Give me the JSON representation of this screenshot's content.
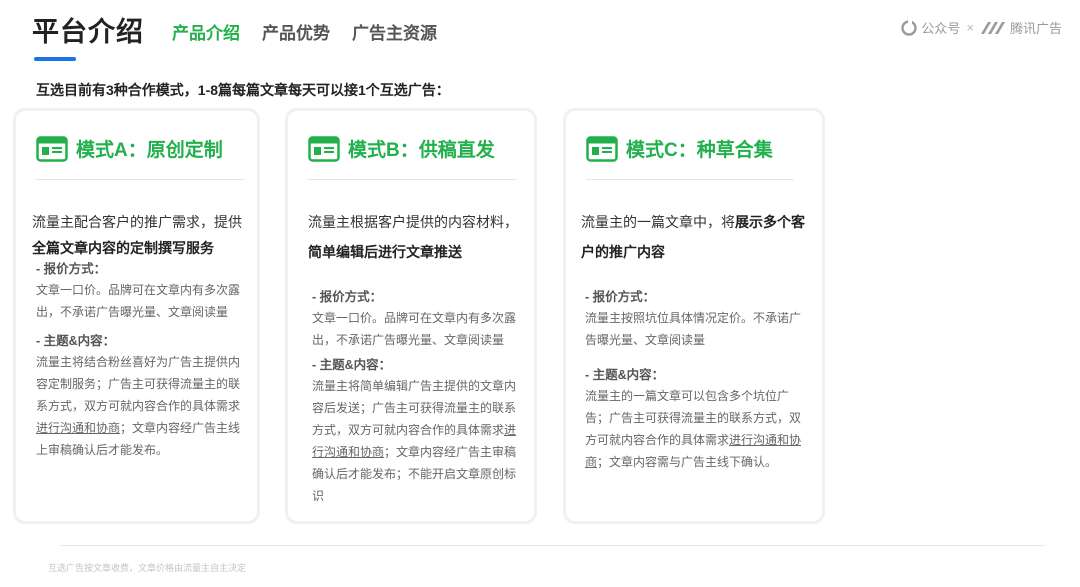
{
  "header": {
    "title": "平台介绍",
    "tabs": [
      {
        "label": "产品介绍",
        "active": true
      },
      {
        "label": "产品优势",
        "active": false
      },
      {
        "label": "广告主资源",
        "active": false
      }
    ],
    "brand_left": "公众号",
    "brand_sep": "×",
    "brand_right": "腾讯广告"
  },
  "intro": "互选目前有3种合作模式，1-8篇每篇文章每天可以接1个互选广告：",
  "cards": [
    {
      "title": "模式A：原创定制",
      "lead_1": "流量主配合客户的推广需求，提供",
      "lead_2": "全篇文章内容的定制撰写服务",
      "pricing_title": "- 报价方式：",
      "pricing_text": "文章一口价。品牌可在文章内有多次露出，不承诺广告曝光量、文章阅读量",
      "topic_title": "- 主题&内容：",
      "topic_text_1": "流量主将结合粉丝喜好为广告主提供内容定制服务；广告主可获得流量主的联系方式，双方可就内容合作的具体需求",
      "topic_link": "进行沟通和协商",
      "topic_text_2": "；文章内容经广告主线上审稿确认后才能发布。"
    },
    {
      "title": "模式B：供稿直发",
      "lead_1": "流量主根据客户提供的内容材料，",
      "lead_2": "简单编辑后进行文章推送",
      "pricing_title": "- 报价方式：",
      "pricing_text": "文章一口价。品牌可在文章内有多次露出，不承诺广告曝光量、文章阅读量",
      "topic_title": "- 主题&内容：",
      "topic_text_1": "流量主将简单编辑广告主提供的文章内容后发送；广告主可获得流量主的联系方式，双方可就内容合作的具体需求",
      "topic_link": "进行沟通和协商",
      "topic_text_2": "；文章内容经广告主审稿确认后才能发布；不能开启文章原创标识"
    },
    {
      "title": "模式C：种草合集",
      "lead_1": "流量主的一篇文章中，将",
      "lead_bold": "展示多个客户的推广内容",
      "pricing_title": "- 报价方式：",
      "pricing_text": "流量主按照坑位具体情况定价。不承诺广告曝光量、文章阅读量",
      "topic_title": "- 主题&内容：",
      "topic_text_1": "流量主的一篇文章可以包含多个坑位广告；广告主可获得流量主的联系方式，双方可就内容合作的具体需求",
      "topic_link": "进行沟通和协商",
      "topic_text_2": "；文章内容需与广告主线下确认。"
    }
  ],
  "footnote": "互选广告按文章收费，文章价格由流量主自主决定",
  "colors": {
    "accent": "#21b04b",
    "underline": "#1a73e8"
  }
}
